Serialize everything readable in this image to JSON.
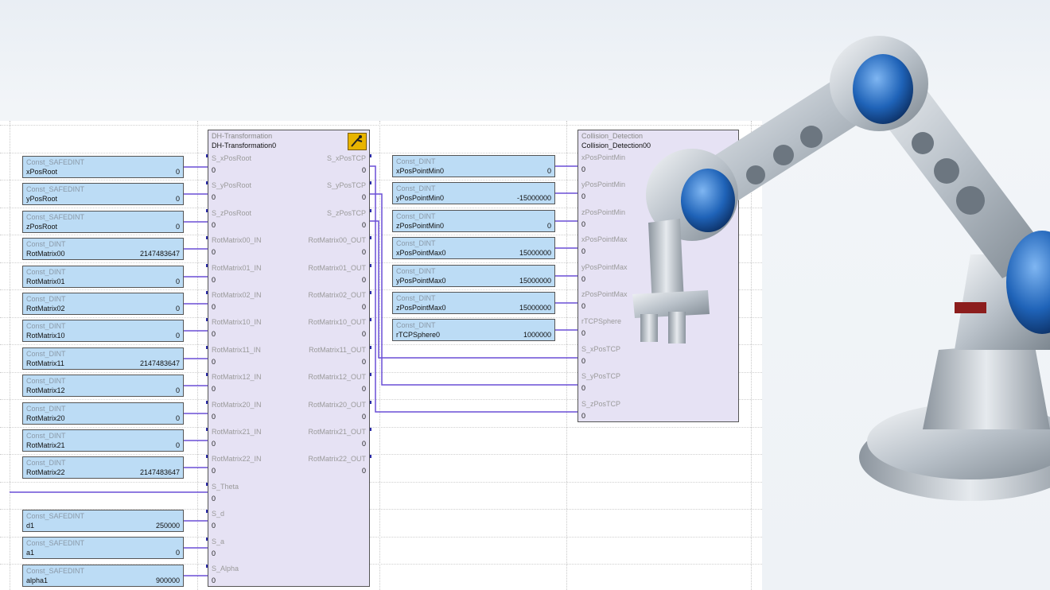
{
  "constants": [
    {
      "type": "Const_SAFEDINT",
      "name": "xPosRoot",
      "value": "0"
    },
    {
      "type": "Const_SAFEDINT",
      "name": "yPosRoot",
      "value": "0"
    },
    {
      "type": "Const_SAFEDINT",
      "name": "zPosRoot",
      "value": "0"
    },
    {
      "type": "Const_DINT",
      "name": "RotMatrix00",
      "value": "2147483647"
    },
    {
      "type": "Const_DINT",
      "name": "RotMatrix01",
      "value": "0"
    },
    {
      "type": "Const_DINT",
      "name": "RotMatrix02",
      "value": "0"
    },
    {
      "type": "Const_DINT",
      "name": "RotMatrix10",
      "value": "0"
    },
    {
      "type": "Const_DINT",
      "name": "RotMatrix11",
      "value": "2147483647"
    },
    {
      "type": "Const_DINT",
      "name": "RotMatrix12",
      "value": "0"
    },
    {
      "type": "Const_DINT",
      "name": "RotMatrix20",
      "value": "0"
    },
    {
      "type": "Const_DINT",
      "name": "RotMatrix21",
      "value": "0"
    },
    {
      "type": "Const_DINT",
      "name": "RotMatrix22",
      "value": "2147483647"
    }
  ],
  "constants_bottom": [
    {
      "type": "Const_SAFEDINT",
      "name": "d1",
      "value": "250000"
    },
    {
      "type": "Const_SAFEDINT",
      "name": "a1",
      "value": "0"
    },
    {
      "type": "Const_SAFEDINT",
      "name": "alpha1",
      "value": "900000"
    }
  ],
  "dh_block": {
    "type": "DH-Transformation",
    "instance": "DH-Transformation0",
    "inputs": [
      "S_xPosRoot",
      "S_yPosRoot",
      "S_zPosRoot",
      "RotMatrix00_IN",
      "RotMatrix01_IN",
      "RotMatrix02_IN",
      "RotMatrix10_IN",
      "RotMatrix11_IN",
      "RotMatrix12_IN",
      "RotMatrix20_IN",
      "RotMatrix21_IN",
      "RotMatrix22_IN",
      "S_Theta",
      "S_d",
      "S_a",
      "S_Alpha"
    ],
    "outputs": [
      "S_xPosTCP",
      "S_yPosTCP",
      "S_zPosTCP",
      "RotMatrix00_OUT",
      "RotMatrix01_OUT",
      "RotMatrix02_OUT",
      "RotMatrix10_OUT",
      "RotMatrix11_OUT",
      "RotMatrix12_OUT",
      "RotMatrix20_OUT",
      "RotMatrix21_OUT",
      "RotMatrix22_OUT"
    ],
    "zero": "0"
  },
  "mid_constants": [
    {
      "type": "Const_DINT",
      "name": "xPosPointMin0",
      "value": "0"
    },
    {
      "type": "Const_DINT",
      "name": "yPosPointMin0",
      "value": "-15000000"
    },
    {
      "type": "Const_DINT",
      "name": "zPosPointMin0",
      "value": "0"
    },
    {
      "type": "Const_DINT",
      "name": "xPosPointMax0",
      "value": "15000000"
    },
    {
      "type": "Const_DINT",
      "name": "yPosPointMax0",
      "value": "15000000"
    },
    {
      "type": "Const_DINT",
      "name": "zPosPointMax0",
      "value": "15000000"
    },
    {
      "type": "Const_DINT",
      "name": "rTCPSphere0",
      "value": "1000000"
    }
  ],
  "collision_block": {
    "type": "Collision_Detection",
    "instance": "Collision_Detection00",
    "inputs": [
      "xPosPointMin",
      "yPosPointMin",
      "zPosPointMin",
      "xPosPointMax",
      "yPosPointMax",
      "zPosPointMax",
      "rTCPSphere",
      "S_xPosTCP",
      "S_yPosTCP",
      "S_zPosTCP"
    ],
    "zero": "0"
  },
  "colors": {
    "const_fill": "#bcdcf5",
    "fb_fill": "#e6e2f4",
    "wire": "#6a4fd6",
    "icon": "#e8b400"
  }
}
